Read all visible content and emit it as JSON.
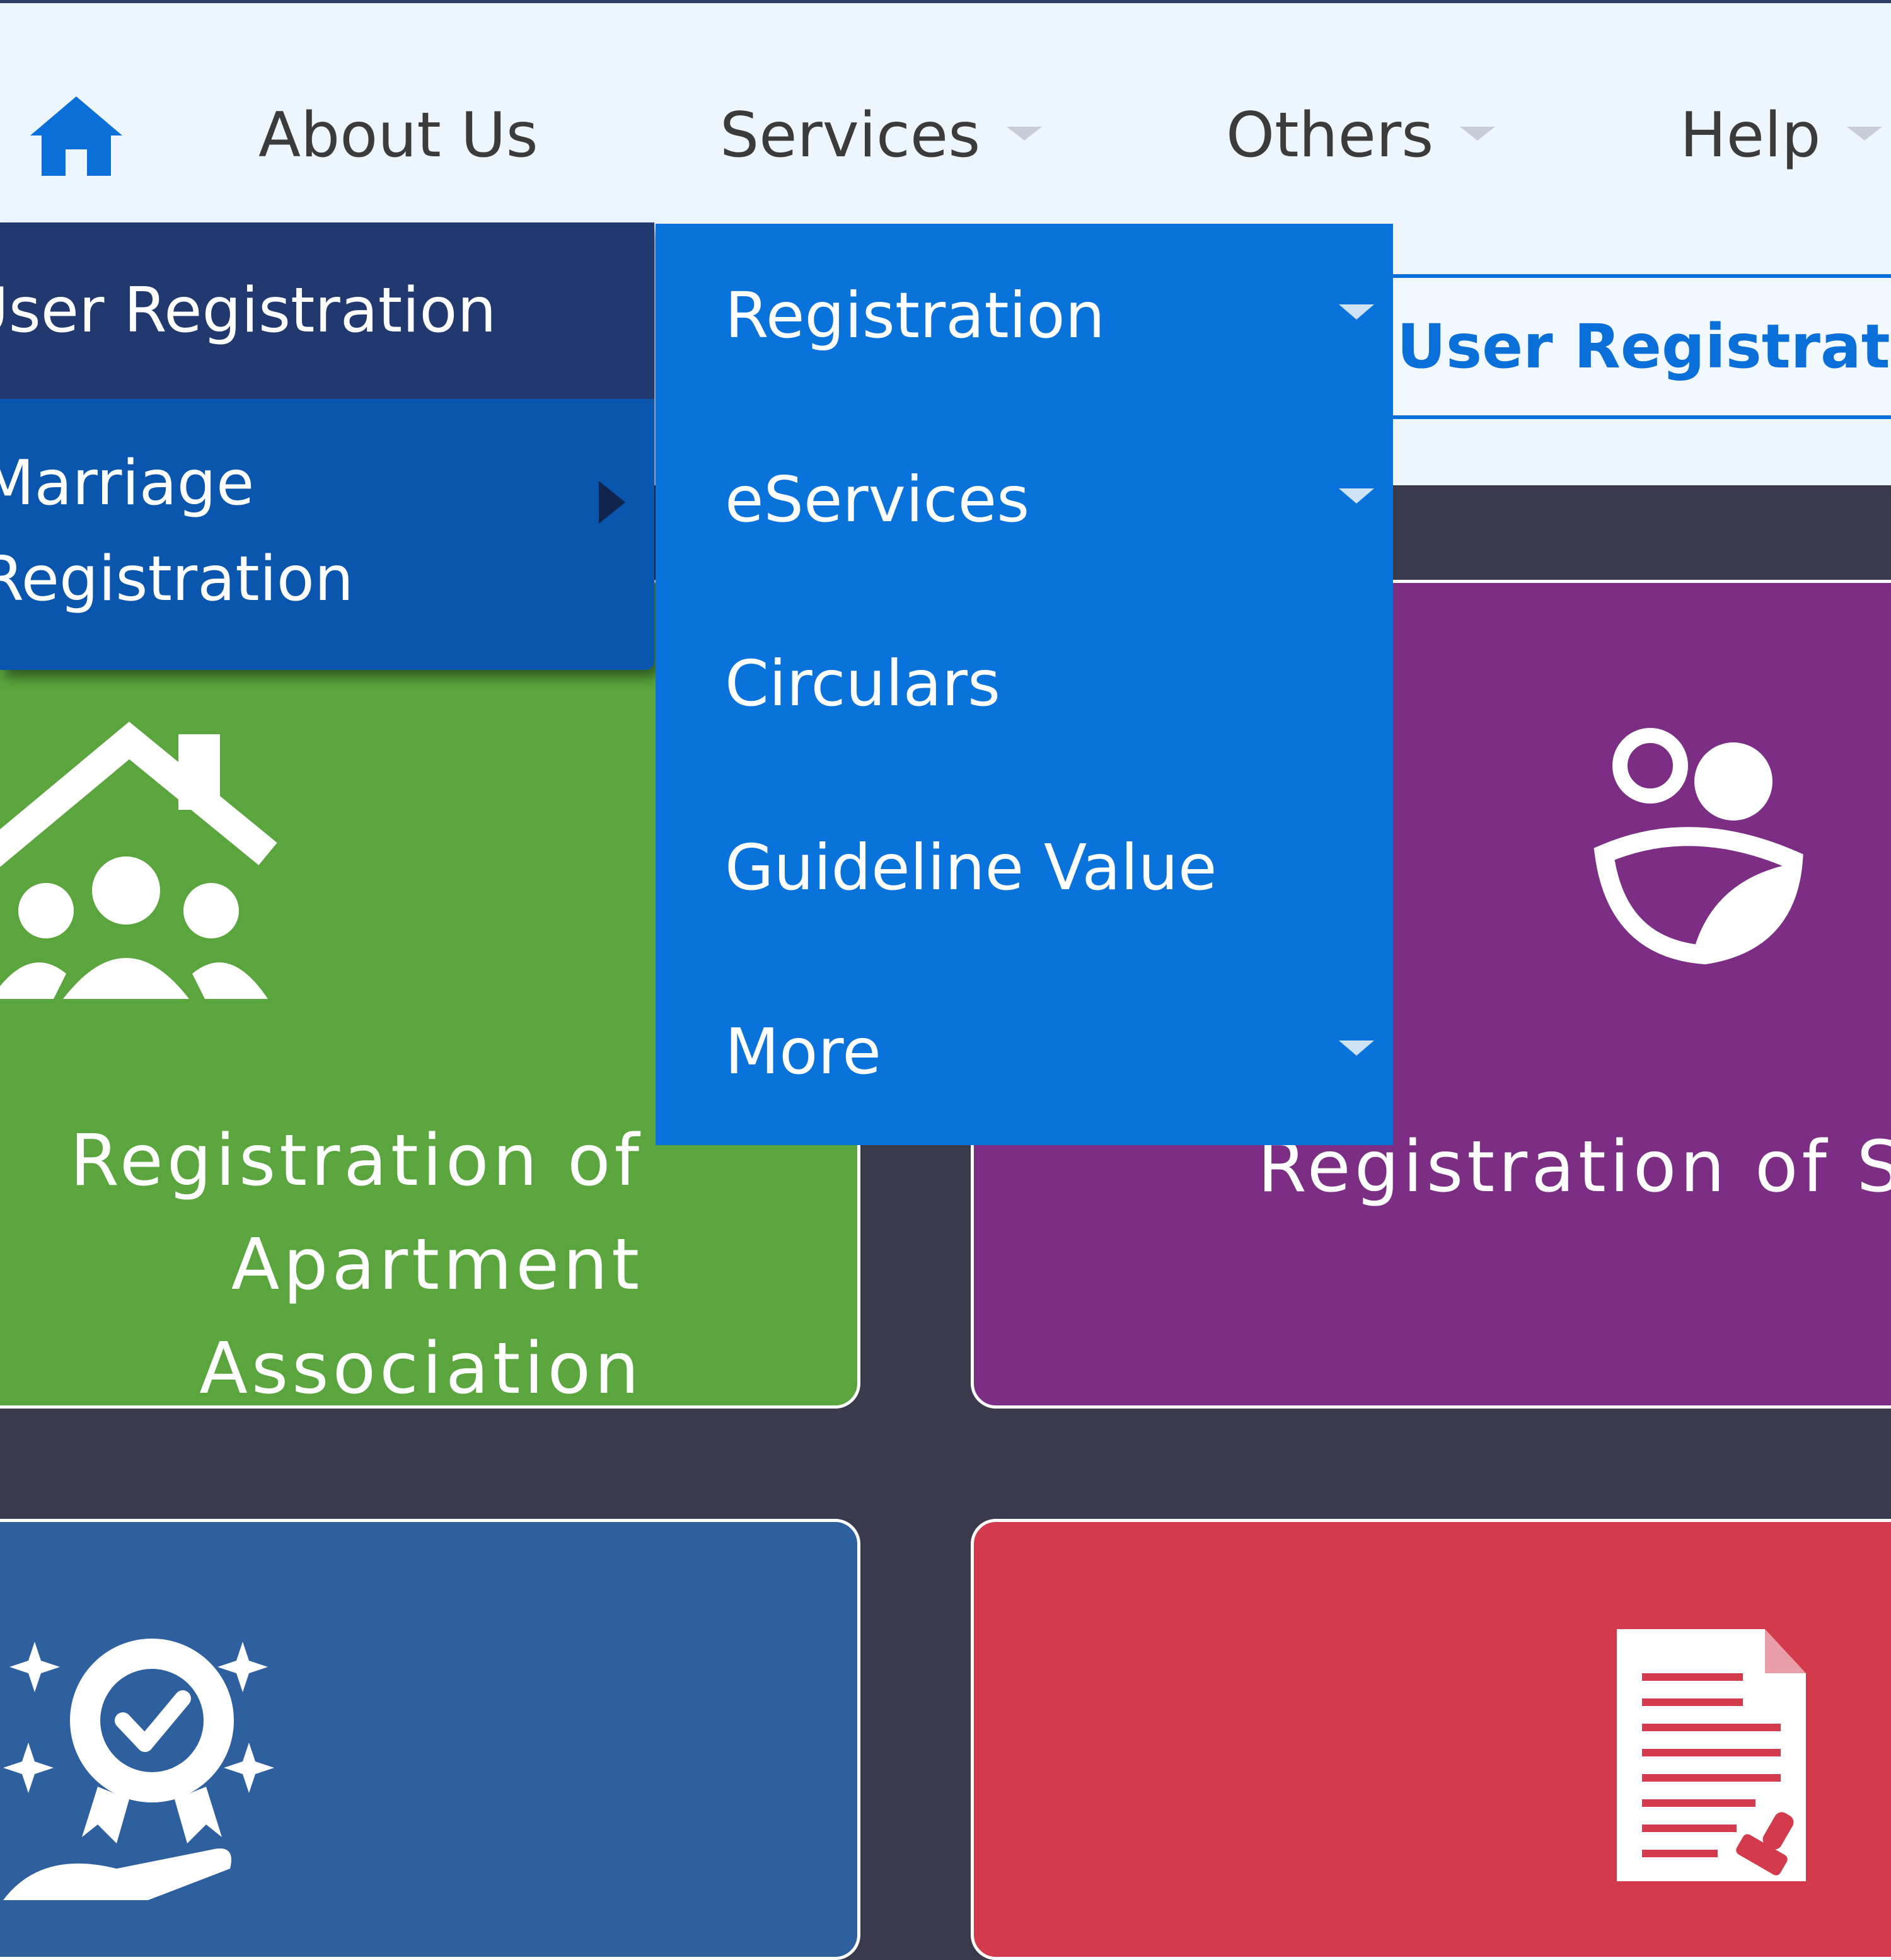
{
  "nav": {
    "home_icon": "home-icon",
    "items": [
      {
        "label": "About Us",
        "has_caret": false
      },
      {
        "label": "Services",
        "has_caret": true
      },
      {
        "label": "Others",
        "has_caret": true
      },
      {
        "label": "Help",
        "has_caret": true
      }
    ]
  },
  "user_registration_button": "User Registration",
  "left_dropdown": {
    "item1": "User Registration",
    "item2": "Marriage\nRegistration"
  },
  "services_dropdown": {
    "items": [
      {
        "label": "Registration",
        "has_caret": true
      },
      {
        "label": "eServices",
        "has_caret": true
      },
      {
        "label": "Circulars",
        "has_caret": false
      },
      {
        "label": "Guideline Value",
        "has_caret": false
      },
      {
        "label": "More",
        "has_caret": true
      }
    ]
  },
  "cards": {
    "green": {
      "title": "Registration of Apartment\nAssociation",
      "icon": "house-community-icon",
      "color": "#5aa53d"
    },
    "purple": {
      "title": "Registration of S",
      "icon": "people-icon",
      "color": "#7c2d84"
    },
    "blue": {
      "icon": "award-hand-icon",
      "color": "#2e5f9f"
    },
    "red": {
      "icon": "document-stamp-icon",
      "color": "#d33b4d"
    }
  }
}
